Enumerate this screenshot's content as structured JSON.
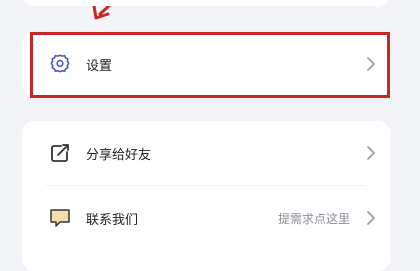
{
  "settings": {
    "label": "设置"
  },
  "share": {
    "label": "分享给好友"
  },
  "contact": {
    "label": "联系我们",
    "hint": "提需求点这里"
  },
  "colors": {
    "highlight": "#c62828",
    "icon_accent": "#3b4aa8"
  }
}
